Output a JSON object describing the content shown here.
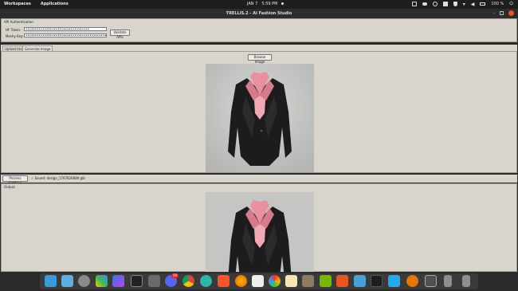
{
  "topbar": {
    "workspaces": "Workspaces",
    "applications": "Applications",
    "date": "JAN 7",
    "time": "5:59 PM",
    "battery": "100 %"
  },
  "window": {
    "title": "TRELLIS.2 - AI Fashion Studio"
  },
  "auth": {
    "header": "API Authentication",
    "hf_label": "HF Token:",
    "hf_value": "••••••••••••••••••••••••••••••••••",
    "meshy_label": "Meshy Key:",
    "meshy_value": "••••••••••••••••••••••••••••••••••••••••••••••",
    "validate_label": "Validate APIs"
  },
  "tabs": [
    {
      "label": "Upload Image",
      "active": true
    },
    {
      "label": "Generate Image",
      "active": false
    }
  ],
  "upload": {
    "browse_label": "Browse Image"
  },
  "status": {
    "process_label": "Process Clothing",
    "message": "✓ Saved: design_1767826889.glb"
  },
  "output": {
    "header": "Output"
  },
  "dock": {
    "discord_badge": "59",
    "icons": [
      "screenshot-icon",
      "image-viewer-icon",
      "settings-icon",
      "apps-grid-icon",
      "copilot-icon",
      "terminal-icon",
      "files-icon",
      "discord-icon",
      "chrome-icon",
      "ubuntu-software-icon",
      "brave-icon",
      "firefox-icon",
      "document-viewer-icon",
      "video-icon",
      "paint-icon",
      "gimp-icon",
      "nvidia-icon",
      "clapper-icon",
      "photo-icon",
      "vscode-icon",
      "blender-icon",
      "inkscape-icon",
      "usb-drive-icon",
      "usb-drive-2-icon"
    ]
  }
}
